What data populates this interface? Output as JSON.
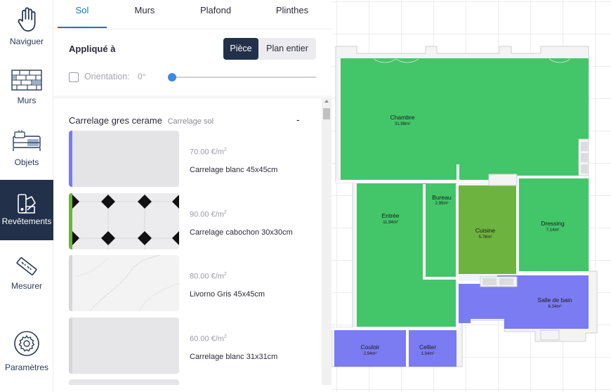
{
  "toolbar": {
    "items": [
      {
        "label": "Naviguer",
        "icon": "hand-icon"
      },
      {
        "label": "Murs",
        "icon": "brick-wall-icon"
      },
      {
        "label": "Objets",
        "icon": "furniture-icon"
      },
      {
        "label": "Revêtements",
        "icon": "paint-swatch-icon",
        "active": true
      },
      {
        "label": "Mesurer",
        "icon": "ruler-icon"
      },
      {
        "label": "Paramètres",
        "icon": "gear-icon"
      }
    ]
  },
  "tabs": [
    {
      "label": "Sol",
      "active": true
    },
    {
      "label": "Murs"
    },
    {
      "label": "Plafond"
    },
    {
      "label": "Plinthes"
    }
  ],
  "apply": {
    "label": "Appliqué à",
    "options": [
      {
        "label": "Pièce",
        "active": true
      },
      {
        "label": "Plan entier"
      }
    ]
  },
  "orientation": {
    "label": "Orientation:",
    "value": "0°",
    "checked": false
  },
  "category": {
    "title": "Carrelage gres cerame",
    "subtitle": "Carrelage sol",
    "collapse": "-"
  },
  "products": [
    {
      "price": "70.00 €/m",
      "unit_sup": "2",
      "name": "Carrelage blanc 45x45cm",
      "accent": "#7b7bf2",
      "pattern": "plain"
    },
    {
      "price": "90.00 €/m",
      "unit_sup": "2",
      "name": "Carrelage cabochon 30x30cm",
      "accent": "#6db33f",
      "pattern": "cabochon"
    },
    {
      "price": "80.00 €/m",
      "unit_sup": "2",
      "name": "Livorno Gris 45x45cm",
      "accent": "#d6d6da",
      "pattern": "marble"
    },
    {
      "price": "60.00 €/m",
      "unit_sup": "2",
      "name": "Carrelage blanc 31x31cm",
      "accent": "#d6d6da",
      "pattern": "plain"
    }
  ],
  "rooms": [
    {
      "name": "Chambre",
      "area": "31.99m²",
      "color": "#43c56a"
    },
    {
      "name": "Entrée",
      "area": "11.94m²",
      "color": "#43c56a"
    },
    {
      "name": "Bureau",
      "area": "2.95m²",
      "color": "#43c56a"
    },
    {
      "name": "Cuisine",
      "area": "5.76m²",
      "color": "#6db33f"
    },
    {
      "name": "Dressing",
      "area": "7.14m²",
      "color": "#43c56a"
    },
    {
      "name": "Salle de bain",
      "area": "6.34m²",
      "color": "#7b7bf2"
    },
    {
      "name": "Couloir",
      "area": "2.94m²",
      "color": "#7b7bf2"
    },
    {
      "name": "Cellier",
      "area": "1.94m²",
      "color": "#7b7bf2"
    }
  ],
  "colors": {
    "accent_blue": "#1a73c8",
    "nav_dark": "#22304a",
    "floor_green": "#43c56a",
    "floor_olive": "#6db33f",
    "floor_violet": "#7b7bf2"
  }
}
